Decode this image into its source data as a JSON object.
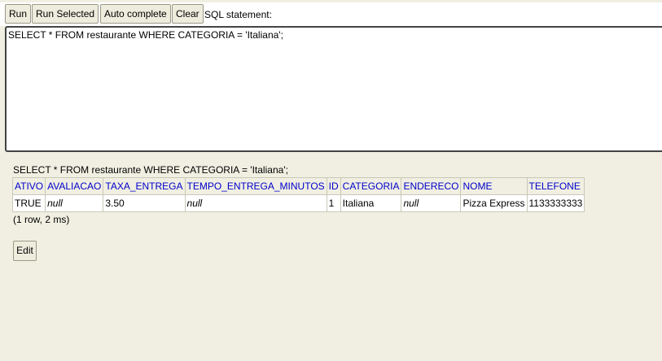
{
  "toolbar": {
    "run_label": "Run",
    "run_selected_label": "Run Selected",
    "auto_complete_label": "Auto complete",
    "clear_label": "Clear",
    "sql_statement_label": "SQL statement:"
  },
  "editor": {
    "sql_text": "SELECT * FROM restaurante WHERE CATEGORIA = 'Italiana';"
  },
  "result": {
    "query_echo": "SELECT * FROM restaurante WHERE CATEGORIA = 'Italiana';",
    "columns": [
      "ATIVO",
      "AVALIACAO",
      "TAXA_ENTREGA",
      "TEMPO_ENTREGA_MINUTOS",
      "ID",
      "CATEGORIA",
      "ENDERECO",
      "NOME",
      "TELEFONE"
    ],
    "rows": [
      [
        "TRUE",
        "null",
        "3.50",
        "null",
        "1",
        "Italiana",
        "null",
        "Pizza Express",
        "1133333333"
      ]
    ],
    "row_count_text": "(1 row, 2 ms)",
    "edit_label": "Edit"
  },
  "colors": {
    "background": "#f0efe2",
    "header_link": "#0000cc",
    "editor_border": "#444444"
  }
}
